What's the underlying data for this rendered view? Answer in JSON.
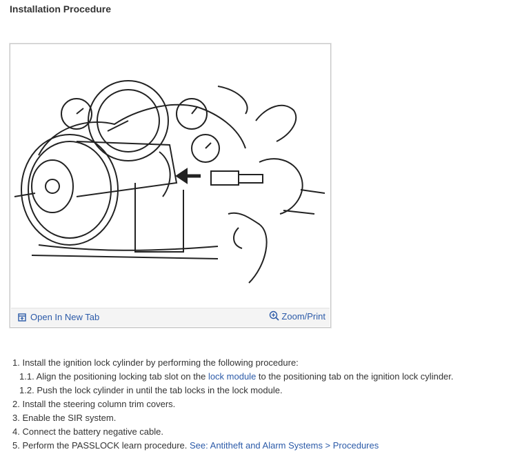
{
  "title": "Installation Procedure",
  "figure": {
    "open_tab_label": "Open In New Tab",
    "zoom_label": "Zoom/Print",
    "icons": [
      "open-new-tab-icon",
      "zoom-icon"
    ]
  },
  "steps": [
    {
      "num": "1.",
      "text": "Install the ignition lock cylinder by performing the following procedure:"
    },
    {
      "num": "1.1.",
      "pre": "Align the positioning locking tab slot on the ",
      "link": "lock module",
      "post": " to the positioning tab on the ignition lock cylinder."
    },
    {
      "num": "1.2.",
      "text": "Push the lock cylinder in until the tab locks in the lock module."
    },
    {
      "num": "2.",
      "text": "Install the steering column trim covers."
    },
    {
      "num": "3.",
      "text": "Enable the SIR system."
    },
    {
      "num": "4.",
      "text": "Connect the battery negative cable."
    },
    {
      "num": "5.",
      "pre": "Perform the PASSLOCK learn procedure. ",
      "link": "See: Antitheft and Alarm Systems > Procedures"
    }
  ],
  "colors": {
    "link": "#2b5aa8",
    "text": "#333333"
  }
}
